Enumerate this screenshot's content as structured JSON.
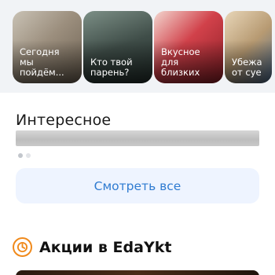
{
  "stories": [
    {
      "caption": "Сегодня\nмы\nпойдём..."
    },
    {
      "caption": "Кто твой\nпарень?"
    },
    {
      "caption": "Вкусное\nдля\nблизких"
    },
    {
      "caption": "Убежа\nот суе"
    }
  ],
  "interesting": {
    "title": "Интересное",
    "see_all_label": "Смотреть все"
  },
  "promos": {
    "title": "Акции в EdaYkt",
    "icon": "timer-icon"
  },
  "colors": {
    "accent_blue": "#2f7bd1",
    "button_bg": "#eef4ff",
    "promo_icon": "#f08a1c"
  }
}
